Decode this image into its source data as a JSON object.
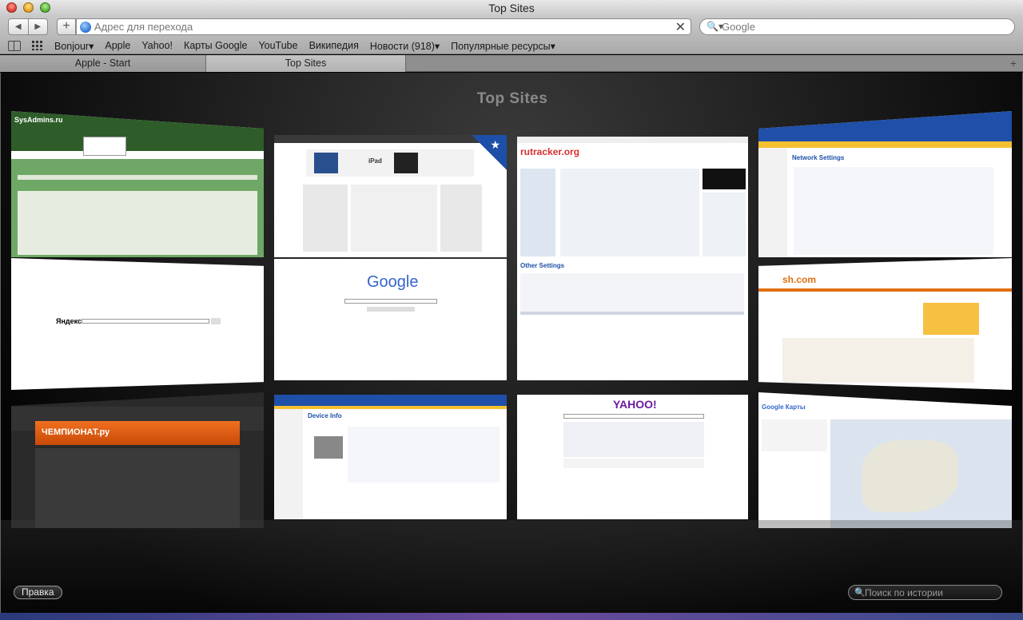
{
  "window": {
    "title": "Top Sites"
  },
  "toolbar": {
    "back_glyph": "◀",
    "forward_glyph": "▶",
    "add_glyph": "+",
    "url_placeholder": "Адрес для перехода",
    "clear_glyph": "✕",
    "search_placeholder": "Google",
    "search_glyph": "🔍▾"
  },
  "bookmarks": {
    "items": [
      {
        "label": "Bonjour▾"
      },
      {
        "label": "Apple"
      },
      {
        "label": "Yahoo!"
      },
      {
        "label": "Карты Google"
      },
      {
        "label": "YouTube"
      },
      {
        "label": "Википедия"
      },
      {
        "label": "Новости (918)▾"
      },
      {
        "label": "Популярные ресурсы▾"
      }
    ]
  },
  "tabs": {
    "items": [
      {
        "label": "Apple - Start"
      },
      {
        "label": "Top Sites"
      }
    ],
    "add_glyph": "+"
  },
  "top_sites": {
    "heading": "Top Sites",
    "edit_label": "Правка",
    "history_search_placeholder": "Поиск по истории",
    "history_search_glyph": "🔍",
    "thumbnails": [
      {
        "site": "sysadmins",
        "logo": "SysAdmins.ru",
        "accent": "#4e8a46",
        "bg": "#5c9a54"
      },
      {
        "site": "apple",
        "logo": "iPad",
        "accent": "#2a4f8f",
        "bg": "#ffffff"
      },
      {
        "site": "rutracker",
        "logo": "rutracker.org",
        "accent": "#d83030",
        "bg": "#ffffff"
      },
      {
        "site": "hp-network",
        "logo": "Network Settings",
        "accent": "#1f4fa8",
        "bg": "#ffffff"
      },
      {
        "site": "yandex",
        "logo": "Яндекс",
        "accent": "#d00000",
        "bg": "#ffffff"
      },
      {
        "site": "google",
        "logo": "Google",
        "accent": "#3366cc",
        "bg": "#ffffff"
      },
      {
        "site": "hp-other",
        "logo": "Other Settings",
        "accent": "#1f4fa8",
        "bg": "#ffffff"
      },
      {
        "site": "sh-com",
        "logo": "sh.com",
        "accent": "#e07010",
        "bg": "#ffffff"
      },
      {
        "site": "championat",
        "logo": "ЧЕМПИОНАТ.ру",
        "accent": "#e85a10",
        "bg": "#2a2a2a"
      },
      {
        "site": "hp-device",
        "logo": "Device Info",
        "accent": "#1f4fa8",
        "bg": "#ffffff"
      },
      {
        "site": "yahoo",
        "logo": "YAHOO!",
        "accent": "#6a1ba0",
        "bg": "#ffffff"
      },
      {
        "site": "google-maps",
        "logo": "Google Карты",
        "accent": "#3366cc",
        "bg": "#dde6ee"
      }
    ]
  }
}
